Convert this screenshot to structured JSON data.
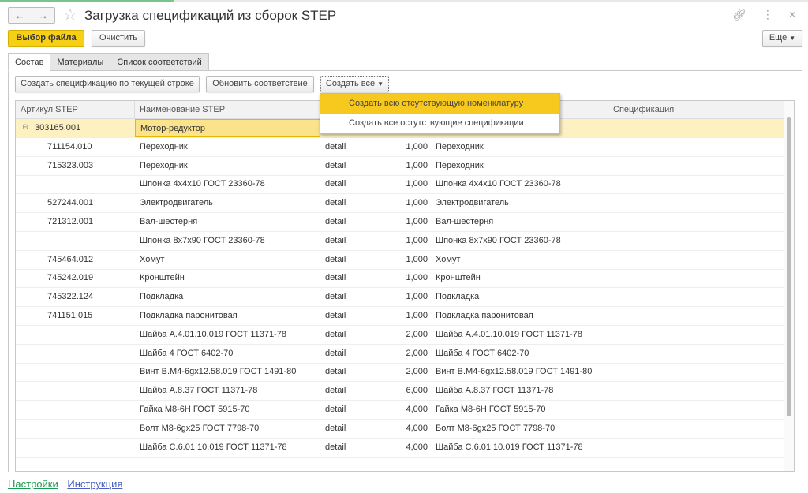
{
  "window": {
    "title": "Загрузка спецификаций из сборок STEP",
    "more_label": "Еще"
  },
  "toolbar": {
    "select_file": "Выбор файла",
    "clear": "Очистить"
  },
  "tabs": [
    "Состав",
    "Материалы",
    "Список соответствий"
  ],
  "actions": {
    "create_spec": "Создать спецификацию по текущей строке",
    "update_match": "Обновить соответствие",
    "create_all": "Создать все"
  },
  "menu": {
    "items": [
      "Создать всю отсутствующую номенклатуру",
      "Создать все остутствующие спецификации"
    ]
  },
  "table": {
    "headers": [
      "Артикул STEP",
      "Наименование STEP",
      "Спецификация"
    ],
    "rows": [
      [
        "303165.001",
        "Мотор-редуктор",
        "",
        "",
        ""
      ],
      [
        "711154.010",
        "Переходник",
        "detail",
        "1,000",
        "Переходник"
      ],
      [
        "715323.003",
        "Переходник",
        "detail",
        "1,000",
        "Переходник"
      ],
      [
        "",
        "Шпонка 4х4х10 ГОСТ 23360-78",
        "detail",
        "1,000",
        "Шпонка 4х4х10 ГОСТ 23360-78"
      ],
      [
        "527244.001",
        "Электродвигатель",
        "detail",
        "1,000",
        "Электродвигатель"
      ],
      [
        "721312.001",
        "Вал-шестерня",
        "detail",
        "1,000",
        "Вал-шестерня"
      ],
      [
        "",
        "Шпонка 8х7х90 ГОСТ 23360-78",
        "detail",
        "1,000",
        "Шпонка 8х7х90 ГОСТ 23360-78"
      ],
      [
        "745464.012",
        "Хомут",
        "detail",
        "1,000",
        "Хомут"
      ],
      [
        "745242.019",
        "Кронштейн",
        "detail",
        "1,000",
        "Кронштейн"
      ],
      [
        "745322.124",
        "Подкладка",
        "detail",
        "1,000",
        "Подкладка"
      ],
      [
        "741151.015",
        "Подкладка паронитовая",
        "detail",
        "1,000",
        "Подкладка паронитовая"
      ],
      [
        "",
        "Шайба А.4.01.10.019 ГОСТ 11371-78",
        "detail",
        "2,000",
        "Шайба А.4.01.10.019 ГОСТ 11371-78"
      ],
      [
        "",
        "Шайба 4 ГОСТ 6402-70",
        "detail",
        "2,000",
        "Шайба 4 ГОСТ 6402-70"
      ],
      [
        "",
        "Винт В.М4-6gx12.58.019 ГОСТ 1491-80",
        "detail",
        "2,000",
        "Винт В.М4-6gx12.58.019 ГОСТ 1491-80"
      ],
      [
        "",
        "Шайба А.8.37 ГОСТ 11371-78",
        "detail",
        "6,000",
        "Шайба А.8.37 ГОСТ 11371-78"
      ],
      [
        "",
        "Гайка М8-6Н ГОСТ 5915-70",
        "detail",
        "4,000",
        "Гайка М8-6Н ГОСТ 5915-70"
      ],
      [
        "",
        "Болт М8-6gx25 ГОСТ 7798-70",
        "detail",
        "4,000",
        "Болт М8-6gx25 ГОСТ 7798-70"
      ],
      [
        "",
        "Шайба С.6.01.10.019 ГОСТ 11371-78",
        "detail",
        "4,000",
        "Шайба С.6.01.10.019 ГОСТ 11371-78"
      ]
    ]
  },
  "footer": {
    "settings": "Настройки",
    "instructions": "Инструкция"
  },
  "colors": {
    "accent": "#f5d016",
    "selected_row": "#fdf1c2",
    "link_green": "#1a9a50",
    "link_blue": "#4a5fc1"
  }
}
